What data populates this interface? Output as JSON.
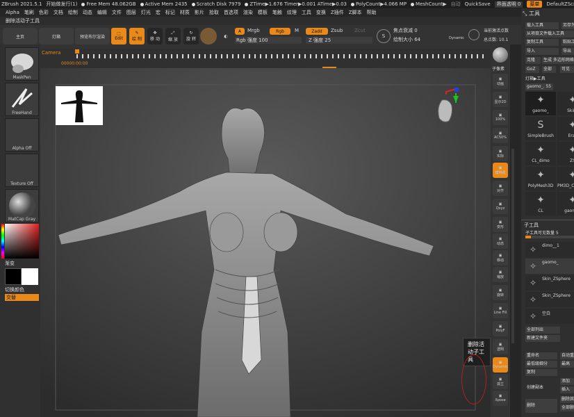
{
  "titlebar": {
    "app": "ZBrush 2021.5.1",
    "release": "开始做发行(1)",
    "free_mem": "Free Mem 48.062GB",
    "active_mem": "Active Mem 2435",
    "scratch": "Scratch Disk 7979",
    "ztime": "ZTime▶1.676 Timer▶0.001 ATime▶0.03",
    "polycount": "PolyCount▶4.066 MP",
    "meshcount": "MeshCount▶",
    "autosave": "自动",
    "quicksave": "QuickSave",
    "transparency": "界面透明 0",
    "menu": "菜单",
    "script": "DefaultZScript"
  },
  "menubar": [
    "Alpha",
    "笔刷",
    "色彩",
    "文档",
    "绘制",
    "动态",
    "编辑",
    "文件",
    "图层",
    "灯光",
    "宏",
    "标记",
    "材质",
    "影片",
    "拾取",
    "首选项",
    "渲染",
    "模板",
    "笔触",
    "纹理",
    "工具",
    "变换",
    "Z插件",
    "Z脚本",
    "帮助"
  ],
  "active_tool_label": "删除活动子工具",
  "shelf": {
    "home": "主页",
    "lightbox": "灯箱",
    "bpr": "预览布尔渲染",
    "edit": "Edit",
    "draw": "绘 制",
    "move": "移 动",
    "scale": "缩 放",
    "rotate": "旋 转",
    "a_label": "A",
    "mrgb": "Mrgb",
    "rgb": "Rgb",
    "m": "M",
    "zadd": "Zadd",
    "zsub": "Zsub",
    "zcut": "Zcut",
    "rgb_intensity": "Rgb 强度 100",
    "z_intensity": "Z 强度 25",
    "focal_shift": "焦点衰减 0",
    "draw_size": "绘制大小 64",
    "dynamic": "Dynamic",
    "active_points": "当前激活点数",
    "total_points": "总点数: 10.1"
  },
  "left": {
    "brush": "MaskPen",
    "stroke": "FreeHand",
    "alpha": "Alpha Off",
    "texture": "Texture Off",
    "material": "MatCap Gray",
    "gradient": "渐变",
    "switch_color": "切换颜色",
    "alternate": "交替"
  },
  "timeline": {
    "label": "Camera",
    "time": "00000:00:00"
  },
  "rightstrip": [
    "动画",
    "显示2D",
    "100%",
    "AC50%",
    "实际",
    "模特视",
    "对齐",
    "Qxyz",
    "变形",
    "动态",
    "移动",
    "缩放",
    "旋转",
    "Line Fill",
    "PolyF",
    "透明",
    "Dynamic",
    "孤立",
    "Xpose"
  ],
  "rightstrip_top": "子像素",
  "tooltip": "删除活动子工具",
  "toolpanel": {
    "title": "工具",
    "load": "载入工具",
    "save_as": "另存为",
    "load_from_project": "从项目文件载入工具",
    "copy_tool": "复制工具",
    "paste": "粘贴工具",
    "import": "导入",
    "export": "导出",
    "clone": "克隆",
    "make_polymesh": "生成 多边形网格",
    "goz": "GoZ",
    "all": "全部",
    "visible": "可见",
    "lightbox_tools": "灯箱▶工具",
    "current_tool": "gaomo_. 55",
    "tools": [
      "gaomo_",
      "Skin_",
      "SimpleBrush",
      "Eras",
      "CL_dimo",
      "ZS",
      "PolyMesh3D",
      "PM3D_Cylinder3",
      "CL",
      "gaomo_"
    ],
    "subtool": "子工具",
    "subtool_count": "子工具可见数量 5",
    "subtools": [
      "dimo__1",
      "gaomo_",
      "Skin_ZSphere",
      "Skin_ZSphere",
      "空白"
    ],
    "list_all": "全部列出",
    "new_folder": "新建文件夹",
    "rename": "重命名",
    "auto_reorder": "自动重",
    "lowest_res": "最低级细分",
    "highest": "最高",
    "duplicate": "复制",
    "append": "添加",
    "insert": "插入",
    "create_copy": "创建副本",
    "delete": "删除",
    "delete_other": "删除其他",
    "delete_all": "全部删"
  }
}
